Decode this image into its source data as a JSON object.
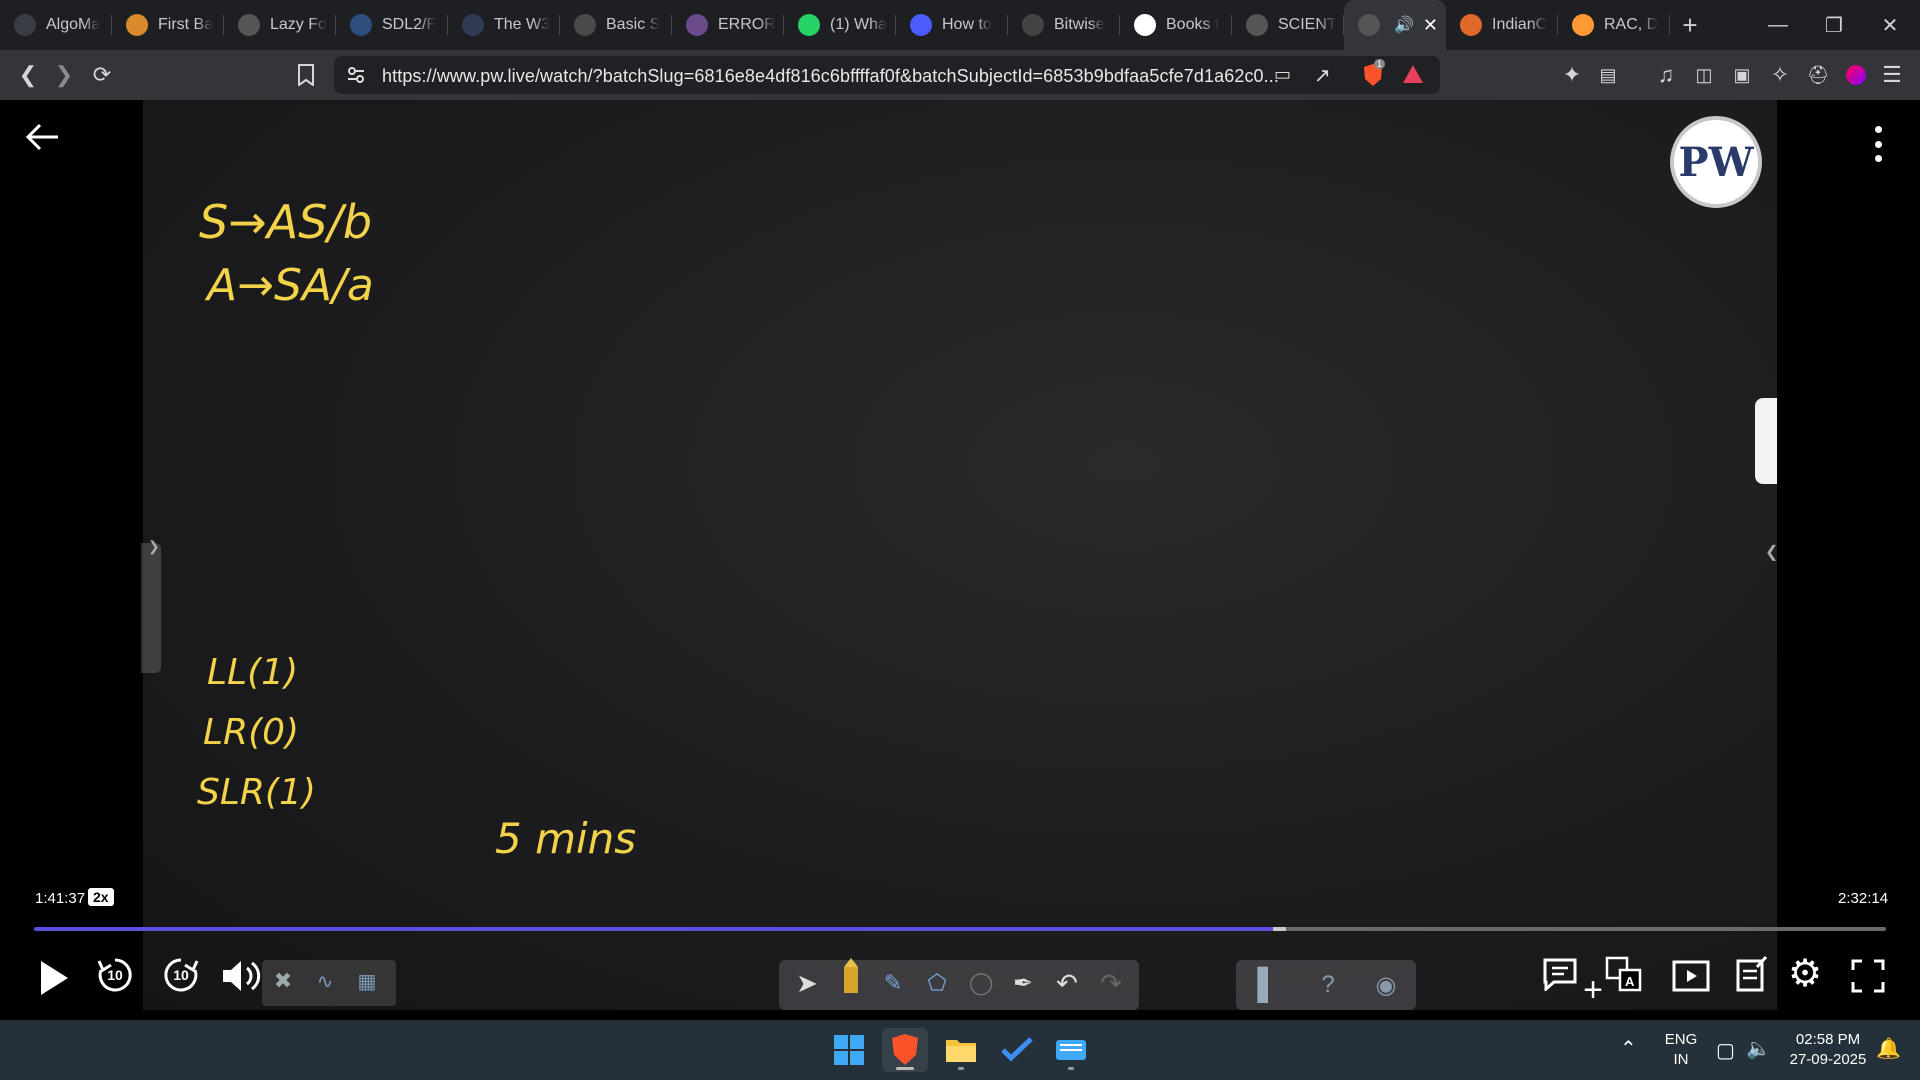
{
  "tabs": [
    {
      "title": "AlgoMa",
      "icon": "algo-icon",
      "color": "#3a3d45"
    },
    {
      "title": "First Ba",
      "icon": "bolt-icon",
      "color": "#d88a2c"
    },
    {
      "title": "Lazy Fo",
      "icon": "globe-icon",
      "color": "#555"
    },
    {
      "title": "SDL2/F",
      "icon": "sdl-icon",
      "color": "#2d4e7a"
    },
    {
      "title": "The W3",
      "icon": "w3-icon",
      "color": "#2f3a55"
    },
    {
      "title": "Basic S",
      "icon": "cpp-icon",
      "color": "#4a4a4a"
    },
    {
      "title": "ERROR",
      "icon": "error-icon",
      "color": "#6a4a8a"
    },
    {
      "title": "(1) Wha",
      "icon": "whatsapp-icon",
      "color": "#25d366"
    },
    {
      "title": "How to",
      "icon": "bookmark-icon",
      "color": "#4b5cff"
    },
    {
      "title": "Bitwise",
      "icon": "bitwise-icon",
      "color": "#444"
    },
    {
      "title": "Books f",
      "icon": "google-icon",
      "color": "#fff"
    },
    {
      "title": "SCIENT",
      "icon": "globe-icon",
      "color": "#555"
    },
    {
      "title": "",
      "icon": "audio-icon",
      "color": "#555",
      "active": true
    },
    {
      "title": "IndianC",
      "icon": "basketball-icon",
      "color": "#e0692a"
    },
    {
      "title": "RAC, D",
      "icon": "india-flag-icon",
      "color": "#ff9933"
    }
  ],
  "url": "https://www.pw.live/watch/?batchSlug=6816e8e4df816c6bffffaf0f&batchSubjectId=6853b9bdfaa5cfe7d1a62c0...",
  "shield_badge": "1",
  "board": {
    "line1": "S→AS/b",
    "line2": "A→SA/a",
    "parsers": [
      "LL(1)",
      "LR(0)",
      "SLR(1)"
    ],
    "note": "5 mins"
  },
  "logo_text": "PW",
  "player": {
    "current_time": "1:41:37",
    "speed": "2x",
    "total_time": "2:32:14",
    "progress_fraction": 0.669,
    "buffer_fraction": 0.676,
    "rewind_label": "10",
    "forward_label": "10"
  },
  "taskbar": {
    "lang_line1": "ENG",
    "lang_line2": "IN",
    "time": "02:58 PM",
    "date": "27-09-2025"
  },
  "colors": {
    "chalk": "#f2d34a",
    "progress": "#5a4fe0",
    "taskbar": "#24303a"
  }
}
